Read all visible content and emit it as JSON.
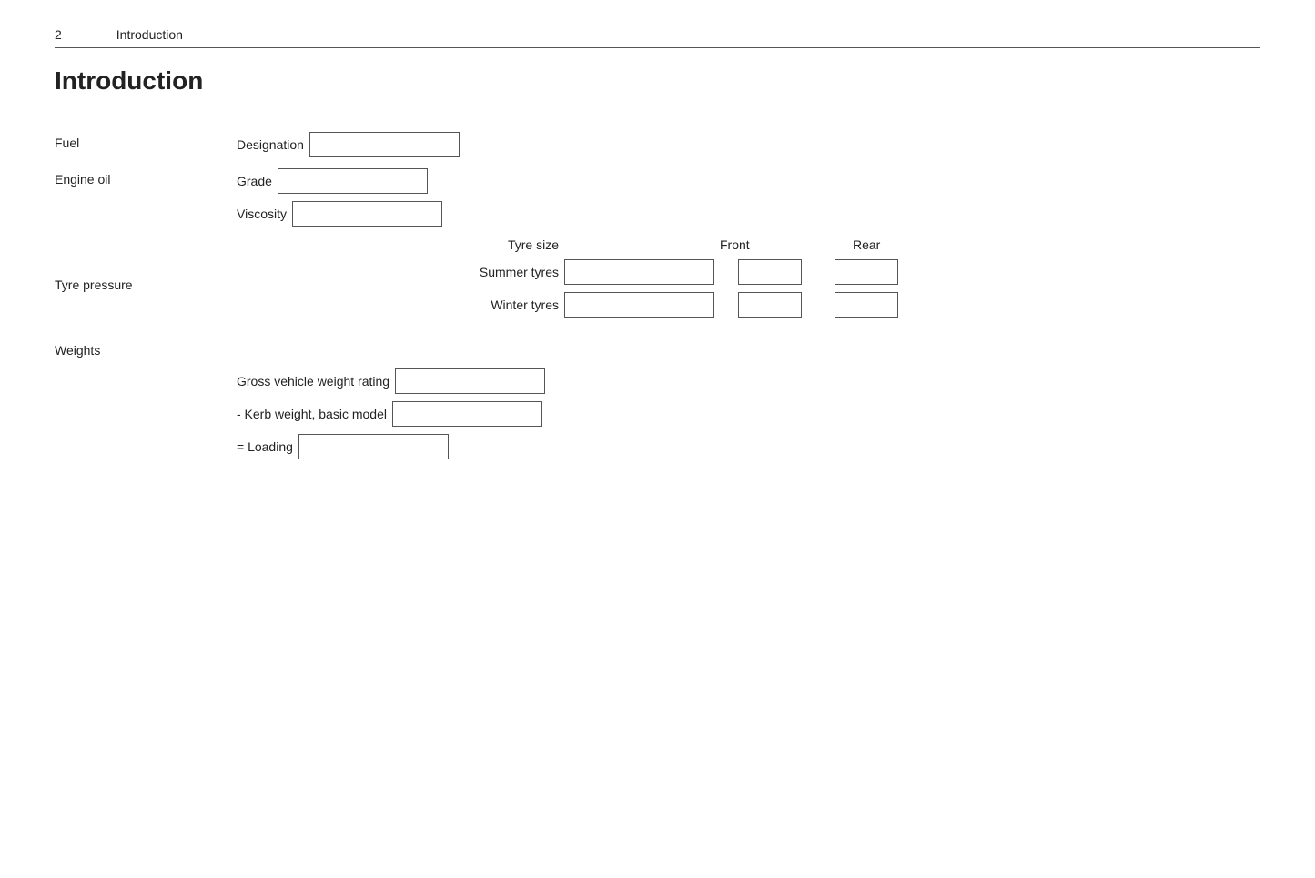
{
  "header": {
    "page_number": "2",
    "title": "Introduction"
  },
  "page_title": "Introduction",
  "sections": {
    "fuel": {
      "label": "Fuel",
      "fields": [
        {
          "label": "Designation",
          "id": "fuel-designation"
        }
      ]
    },
    "engine_oil": {
      "label": "Engine oil",
      "fields": [
        {
          "label": "Grade",
          "id": "engine-oil-grade"
        },
        {
          "label": "Viscosity",
          "id": "engine-oil-viscosity"
        }
      ]
    },
    "tyre_pressure": {
      "label": "Tyre pressure",
      "col_headers": {
        "tyre_size": "Tyre size",
        "front": "Front",
        "rear": "Rear"
      },
      "rows": [
        {
          "label": "Summer tyres",
          "id_size": "summer-size",
          "id_front": "summer-front",
          "id_rear": "summer-rear"
        },
        {
          "label": "Winter tyres",
          "id_size": "winter-size",
          "id_front": "winter-front",
          "id_rear": "winter-rear"
        }
      ]
    },
    "weights": {
      "label": "Weights",
      "fields": [
        {
          "label": "Gross vehicle weight rating",
          "id": "gross-weight"
        },
        {
          "label": "- Kerb weight, basic model",
          "id": "kerb-weight"
        },
        {
          "label": "= Loading",
          "id": "loading"
        }
      ]
    }
  }
}
